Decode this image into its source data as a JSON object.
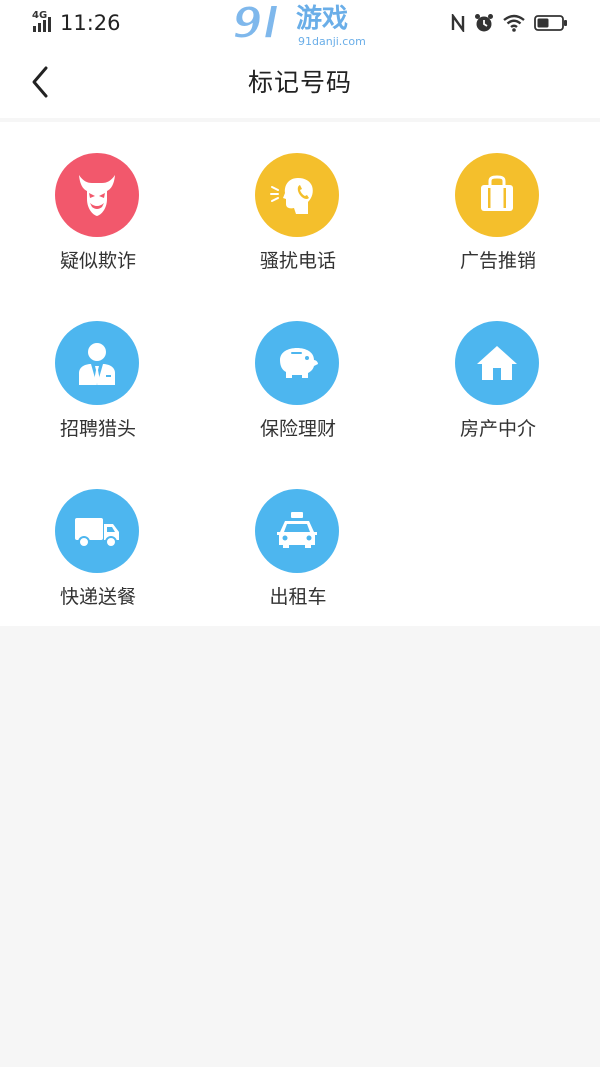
{
  "status_bar": {
    "network": "4G",
    "time": "11:26"
  },
  "watermark": {
    "number": "9l",
    "chinese": "游戏",
    "url": "91danji.com"
  },
  "header": {
    "title": "标记号码"
  },
  "colors": {
    "red": "#f2586c",
    "yellow": "#f4bf2c",
    "blue": "#4db6ef"
  },
  "categories": [
    {
      "label": "疑似欺诈",
      "icon": "devil-icon",
      "color": "#f2586c"
    },
    {
      "label": "骚扰电话",
      "icon": "harassing-phone-icon",
      "color": "#f4bf2c"
    },
    {
      "label": "广告推销",
      "icon": "shopping-bag-icon",
      "color": "#f4bf2c"
    },
    {
      "label": "招聘猎头",
      "icon": "businessman-icon",
      "color": "#4db6ef"
    },
    {
      "label": "保险理财",
      "icon": "piggy-bank-icon",
      "color": "#4db6ef"
    },
    {
      "label": "房产中介",
      "icon": "house-icon",
      "color": "#4db6ef"
    },
    {
      "label": "快递送餐",
      "icon": "delivery-truck-icon",
      "color": "#4db6ef"
    },
    {
      "label": "出租车",
      "icon": "taxi-icon",
      "color": "#4db6ef"
    }
  ]
}
